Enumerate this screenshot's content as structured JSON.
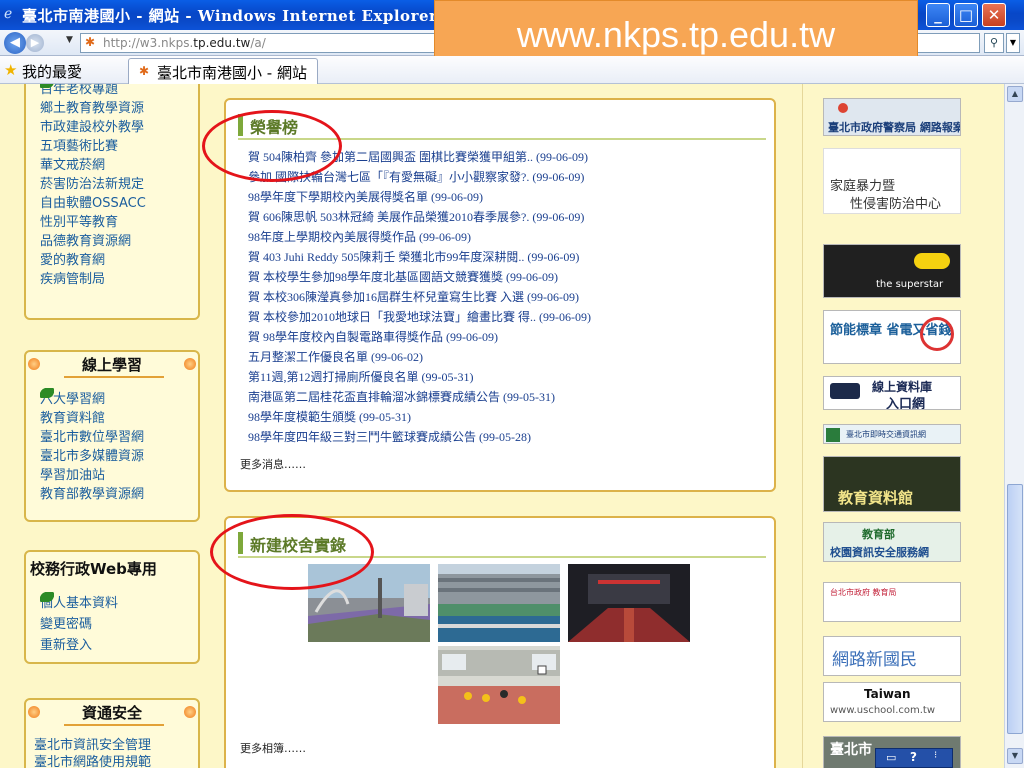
{
  "window": {
    "title": "臺北市南港國小 - 網站 - Windows Internet Explorer",
    "buttons": {
      "minimize": "_",
      "maximize": "□",
      "close": "✕"
    }
  },
  "overlay": {
    "url_banner": "www.nkps.tp.edu.tw"
  },
  "address_bar": {
    "url_prefix": "http://w3.nkps.",
    "url_domain": "tp.edu.tw",
    "url_suffix": "/a/"
  },
  "favorites_bar": {
    "label": "我的最愛",
    "tab": "臺北市南港國小 - 網站"
  },
  "left": {
    "box1_items": [
      "百年老校專題",
      "鄉土教育教學資源",
      "市政建設校外教學",
      "五項藝術比賽",
      "華文戒菸網",
      "菸害防治法新規定",
      "自由軟體OSSACC",
      "性別平等教育",
      "品德教育資源網",
      "愛的教育網",
      "疾病管制局"
    ],
    "box2": {
      "title": "線上學習",
      "items": [
        "六大學習網",
        "教育資料館",
        "臺北市數位學習網",
        "臺北市多媒體資源",
        "學習加油站",
        "教育部教學資源網"
      ]
    },
    "box3": {
      "title": "校務行政Web專用",
      "items": [
        "個人基本資料",
        "變更密碼",
        "重新登入"
      ]
    },
    "box4": {
      "title": "資通安全",
      "items": [
        "臺北市資訊安全管理",
        "臺北市網路使用規範"
      ]
    }
  },
  "honor": {
    "title": "榮譽榜",
    "items": [
      "賀 504陳柏齊 參加第二屆國興盃 圍棋比賽榮獲甲組第.. (99-06-09)",
      "參加 國際扶輪台灣七區「『有愛無礙』小小觀察家發?. (99-06-09)",
      "98學年度下學期校內美展得獎名單 (99-06-09)",
      "賀 606陳思帆 503林冠綺 美展作品榮獲2010春季展參?. (99-06-09)",
      "98年度上學期校內美展得獎作品 (99-06-09)",
      "賀 403 Juhi Reddy 505陳莉壬 榮獲北市99年度深耕閱.. (99-06-09)",
      "賀 本校學生參加98學年度北基區國語文競賽獲獎 (99-06-09)",
      "賀 本校306陳瀅真參加16屆群生杯兒童寫生比賽 入選 (99-06-09)",
      "賀 本校參加2010地球日「我愛地球法寶」繪畫比賽 得.. (99-06-09)",
      "賀 98學年度校內自製電路車得獎作品 (99-06-09)",
      "五月整潔工作優良名單 (99-06-02)",
      "第11週,第12週打掃廁所優良名單 (99-05-31)",
      "南港區第二屆桂花盃直排輪溜冰錦標賽成績公告 (99-05-31)",
      "98學年度模範生頒獎 (99-05-31)",
      "98學年度四年級三對三鬥牛籃球賽成績公告 (99-05-28)"
    ],
    "more": "更多消息……"
  },
  "construction": {
    "title": "新建校舍實錄",
    "more": "更多相簿……"
  },
  "right": {
    "banner1": "臺北市政府警察局 網路報案",
    "banner2_line1": "家庭暴力暨",
    "banner2_line2": "性侵害防治中心",
    "banner3": "the superstar",
    "banner4": "節能標章 省電又省錢",
    "banner5_line1": "線上資料庫",
    "banner5_line2": "入口網",
    "banner6": "臺北市即時交通資訊網",
    "banner7": "教育資料館",
    "banner8_line1": "教育部",
    "banner8_line2": "校園資訊安全服務網",
    "banner9": "台北市政府 教育局",
    "banner10": "網路新國民",
    "banner11_line1": "Taiwan",
    "banner11_line2": "www.uschool.com.tw",
    "banner12": "臺北市"
  },
  "colors": {
    "page_bg": "#fdf7c8",
    "link": "#1a3f8f",
    "accent_green": "#5c7a28",
    "highlight_circle": "#e4141a"
  }
}
